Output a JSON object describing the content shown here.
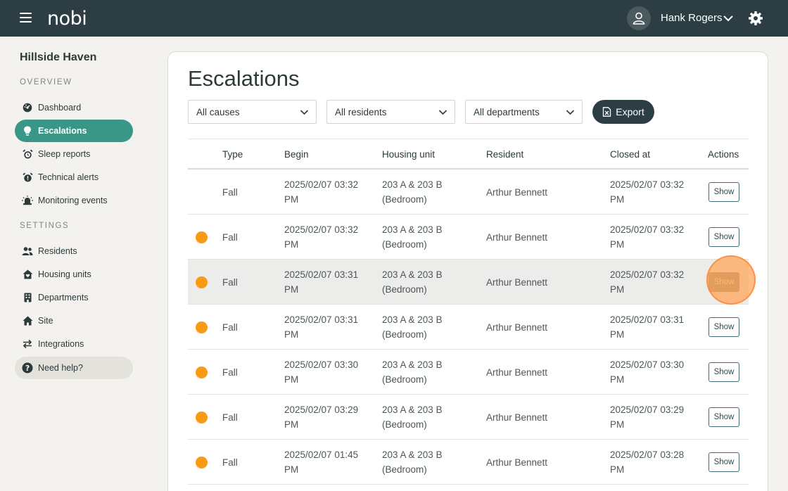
{
  "topbar": {
    "logo": "nobi",
    "user_name": "Hank Rogers"
  },
  "sidebar": {
    "site_name": "Hillside Haven",
    "overview_label": "OVERVIEW",
    "settings_label": "SETTINGS",
    "overview_items": [
      {
        "label": "Dashboard",
        "icon": "dashboard-icon"
      },
      {
        "label": "Escalations",
        "icon": "lightbulb-icon"
      },
      {
        "label": "Sleep reports",
        "icon": "alarm-clock-icon"
      },
      {
        "label": "Technical alerts",
        "icon": "alarm-clock-alert-icon"
      },
      {
        "label": "Monitoring events",
        "icon": "siren-icon"
      }
    ],
    "settings_items": [
      {
        "label": "Residents",
        "icon": "users-icon"
      },
      {
        "label": "Housing units",
        "icon": "house-heart-icon"
      },
      {
        "label": "Departments",
        "icon": "building-icon"
      },
      {
        "label": "Site",
        "icon": "home-icon"
      },
      {
        "label": "Integrations",
        "icon": "arrows-swap-icon"
      }
    ],
    "help_label": "Need help?"
  },
  "main": {
    "title": "Escalations",
    "filters": {
      "causes": "All causes",
      "residents": "All residents",
      "departments": "All departments"
    },
    "export_label": "Export",
    "columns": {
      "type": "Type",
      "begin": "Begin",
      "housing_unit": "Housing unit",
      "resident": "Resident",
      "closed_at": "Closed at",
      "actions": "Actions"
    },
    "show_label": "Show",
    "rows": [
      {
        "dot": false,
        "type": "Fall",
        "begin_1": "2025/02/07 03:32",
        "begin_2": "PM",
        "unit_1": "203 A & 203 B",
        "unit_2": "(Bedroom)",
        "resident": "Arthur Bennett",
        "closed_1": "2025/02/07 03:32",
        "closed_2": "PM"
      },
      {
        "dot": true,
        "type": "Fall",
        "begin_1": "2025/02/07 03:32",
        "begin_2": "PM",
        "unit_1": "203 A & 203 B",
        "unit_2": "(Bedroom)",
        "resident": "Arthur Bennett",
        "closed_1": "2025/02/07 03:32",
        "closed_2": "PM"
      },
      {
        "dot": true,
        "type": "Fall",
        "begin_1": "2025/02/07 03:31",
        "begin_2": "PM",
        "unit_1": "203 A & 203 B",
        "unit_2": "(Bedroom)",
        "resident": "Arthur Bennett",
        "closed_1": "2025/02/07 03:32",
        "closed_2": "PM"
      },
      {
        "dot": true,
        "type": "Fall",
        "begin_1": "2025/02/07 03:31",
        "begin_2": "PM",
        "unit_1": "203 A & 203 B",
        "unit_2": "(Bedroom)",
        "resident": "Arthur Bennett",
        "closed_1": "2025/02/07 03:31",
        "closed_2": "PM"
      },
      {
        "dot": true,
        "type": "Fall",
        "begin_1": "2025/02/07 03:30",
        "begin_2": "PM",
        "unit_1": "203 A & 203 B",
        "unit_2": "(Bedroom)",
        "resident": "Arthur Bennett",
        "closed_1": "2025/02/07 03:30",
        "closed_2": "PM"
      },
      {
        "dot": true,
        "type": "Fall",
        "begin_1": "2025/02/07 03:29",
        "begin_2": "PM",
        "unit_1": "203 A & 203 B",
        "unit_2": "(Bedroom)",
        "resident": "Arthur Bennett",
        "closed_1": "2025/02/07 03:29",
        "closed_2": "PM"
      },
      {
        "dot": true,
        "type": "Fall",
        "begin_1": "2025/02/07 01:45",
        "begin_2": "PM",
        "unit_1": "203 A & 203 B",
        "unit_2": "(Bedroom)",
        "resident": "Arthur Bennett",
        "closed_1": "2025/02/07 03:28",
        "closed_2": "PM"
      }
    ]
  },
  "colors": {
    "topbar": "#2c3e43",
    "accent": "#3a9686",
    "status_dot": "#f89a14"
  }
}
